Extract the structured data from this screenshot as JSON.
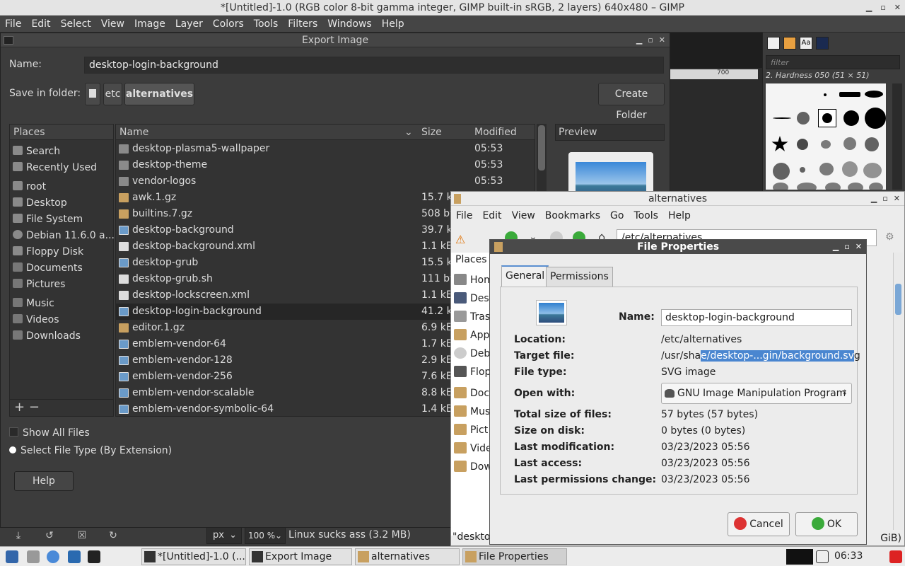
{
  "gimp": {
    "title": "*[Untitled]-1.0 (RGB color 8-bit gamma integer, GIMP built-in sRGB, 2 layers) 640x480 – GIMP",
    "menu": [
      "File",
      "Edit",
      "Select",
      "View",
      "Image",
      "Layer",
      "Colors",
      "Tools",
      "Filters",
      "Windows",
      "Help"
    ],
    "ruler_tick": "700",
    "filter_placeholder": "filter",
    "brush_name": "2. Hardness 050 (51 × 51)",
    "unit": "px",
    "zoom": "100 %",
    "status": "Linux sucks ass (3.2 MB)"
  },
  "export": {
    "title": "Export Image",
    "name_label": "Name:",
    "name_value": "desktop-login-background",
    "save_in_label": "Save in folder:",
    "path": [
      "etc",
      "alternatives"
    ],
    "create_folder": "Create Folder",
    "places_header": "Places",
    "places": [
      "Search",
      "Recently Used",
      "root",
      "Desktop",
      "File System",
      "Debian 11.6.0 a...",
      "Floppy Disk",
      "Documents",
      "Pictures",
      "Music",
      "Videos",
      "Downloads"
    ],
    "columns": {
      "name": "Name",
      "size": "Size",
      "modified": "Modified"
    },
    "files": [
      {
        "name": "desktop-plasma5-wallpaper",
        "size": "",
        "modified": "05:53",
        "kind": "folder"
      },
      {
        "name": "desktop-theme",
        "size": "",
        "modified": "05:53",
        "kind": "folder"
      },
      {
        "name": "vendor-logos",
        "size": "",
        "modified": "05:53",
        "kind": "folder"
      },
      {
        "name": "awk.1.gz",
        "size": "15.7 k",
        "modified": "",
        "kind": "archive"
      },
      {
        "name": "builtins.7.gz",
        "size": "508 by",
        "modified": "",
        "kind": "archive"
      },
      {
        "name": "desktop-background",
        "size": "39.7 k",
        "modified": "",
        "kind": "image"
      },
      {
        "name": "desktop-background.xml",
        "size": "1.1 kB",
        "modified": "",
        "kind": "text"
      },
      {
        "name": "desktop-grub",
        "size": "15.5 k",
        "modified": "",
        "kind": "image"
      },
      {
        "name": "desktop-grub.sh",
        "size": "111 by",
        "modified": "",
        "kind": "text"
      },
      {
        "name": "desktop-lockscreen.xml",
        "size": "1.1 kB",
        "modified": "",
        "kind": "text"
      },
      {
        "name": "desktop-login-background",
        "size": "41.2 k",
        "modified": "",
        "kind": "image"
      },
      {
        "name": "editor.1.gz",
        "size": "6.9 kB",
        "modified": "",
        "kind": "archive"
      },
      {
        "name": "emblem-vendor-64",
        "size": "1.7 kB",
        "modified": "",
        "kind": "image"
      },
      {
        "name": "emblem-vendor-128",
        "size": "2.9 kB",
        "modified": "",
        "kind": "image"
      },
      {
        "name": "emblem-vendor-256",
        "size": "7.6 kB",
        "modified": "",
        "kind": "image"
      },
      {
        "name": "emblem-vendor-scalable",
        "size": "8.8 kB",
        "modified": "",
        "kind": "image"
      },
      {
        "name": "emblem-vendor-symbolic-64",
        "size": "1.4 kB",
        "modified": "",
        "kind": "image"
      }
    ],
    "preview_label": "Preview",
    "show_all_files": "Show All Files",
    "select_file_type": "Select File Type (By Extension)",
    "help": "Help"
  },
  "alternatives": {
    "title": "alternatives",
    "menu": [
      "File",
      "Edit",
      "View",
      "Bookmarks",
      "Go",
      "Tools",
      "Help"
    ],
    "path": "/etc/alternatives",
    "places_header": "Places",
    "places": [
      "Hom",
      "Des",
      "Tras",
      "App",
      "Deb",
      "Flop",
      "Doc",
      "Mus",
      "Pict",
      "Vide",
      "Dow"
    ],
    "status": "\"deskto",
    "status_right": "GiB)"
  },
  "props": {
    "title": "File Properties",
    "tabs": [
      "General",
      "Permissions"
    ],
    "name_label": "Name:",
    "name_value": "desktop-login-background",
    "location_label": "Location:",
    "location": "/etc/alternatives",
    "target_label": "Target file:",
    "target_pre": "/usr/sha",
    "target_sel": "e/desktop-...gin/background.sv",
    "target_post": "g",
    "type_label": "File type:",
    "type": "SVG image",
    "open_with_label": "Open with:",
    "open_with": "GNU Image Manipulation Program",
    "total_label": "Total size of files:",
    "total": "57 bytes (57 bytes)",
    "disk_label": "Size on disk:",
    "disk": "0 bytes (0 bytes)",
    "mod_label": "Last modification:",
    "mod": "03/23/2023 05:56",
    "access_label": "Last access:",
    "access": "03/23/2023 05:56",
    "perm_label": "Last permissions change:",
    "perm": "03/23/2023 05:56",
    "cancel": "Cancel",
    "ok": "OK"
  },
  "taskbar": {
    "tasks": [
      "*[Untitled]-1.0 (...",
      "Export Image",
      "alternatives",
      "File Properties"
    ],
    "clock": "06:33"
  }
}
